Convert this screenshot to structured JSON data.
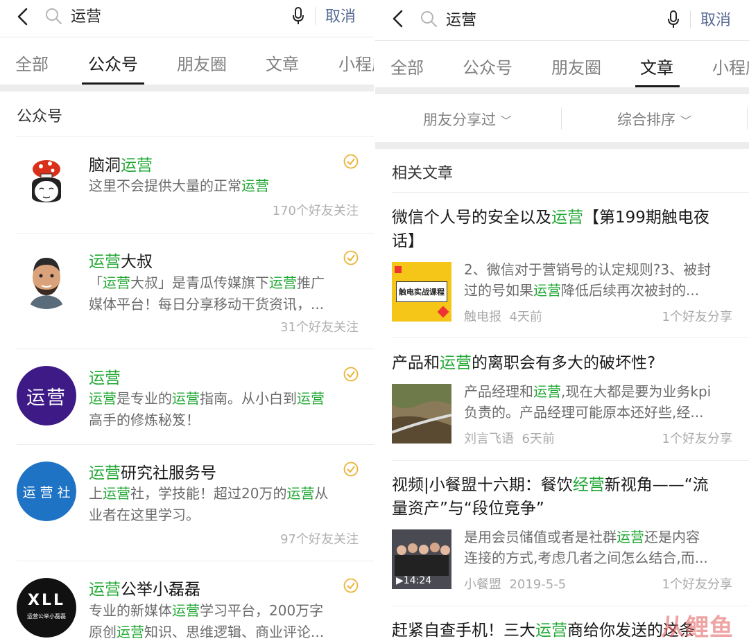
{
  "search": {
    "query": "运营",
    "cancel": "取消"
  },
  "left": {
    "tabs": [
      {
        "label": "全部"
      },
      {
        "label": "公众号"
      },
      {
        "label": "朋友圈"
      },
      {
        "label": "文章"
      },
      {
        "label": "小程序"
      }
    ],
    "active_tab": "公众号",
    "section_title": "公众号",
    "accounts": [
      {
        "name_pre": "脑洞",
        "name_hl": "运营",
        "name_post": "",
        "desc": [
          [
            "这里不会提供大量的正常",
            ""
          ],
          [
            "运营",
            "hl"
          ]
        ],
        "followers": "170个好友关注"
      },
      {
        "name_pre": "",
        "name_hl": "运营",
        "name_post": "大叔",
        "desc_line1": [
          "「",
          "运营",
          "大叔」是青瓜传媒旗下",
          "运营",
          "推广"
        ],
        "desc_line2": "媒体平台！每日分享移动干货资讯，...",
        "followers": "31个好友关注"
      },
      {
        "name_pre": "",
        "name_hl": "运营",
        "name_post": "",
        "avatar_text": "运营",
        "desc_line1": [
          "",
          "运营",
          "是专业的",
          "运营",
          "指南。从小白到",
          "运营"
        ],
        "desc_line2": "高手的修炼秘笈！",
        "followers": ""
      },
      {
        "name_pre": "",
        "name_hl": "运营",
        "name_post": "研究社服务号",
        "avatar_text": "运 营 社",
        "desc_line1": [
          "上",
          "运营",
          "社，学技能！超过20万的",
          "运营",
          "从"
        ],
        "desc_line2": "业者在这里学习。",
        "followers": "97个好友关注"
      },
      {
        "name_pre": "",
        "name_hl": "运营",
        "name_post": "公举小磊磊",
        "avatar_text": "XLL",
        "avatar_sub": "运营公举小磊磊",
        "desc_line1": [
          "专业的新媒体",
          "运营",
          "学习平台，200万字"
        ],
        "desc_line2": [
          "原创",
          "运营",
          "知识、思维逻辑、商业评论..."
        ],
        "followers": ""
      }
    ]
  },
  "right": {
    "tabs": [
      {
        "label": "全部"
      },
      {
        "label": "公众号"
      },
      {
        "label": "朋友圈"
      },
      {
        "label": "文章"
      },
      {
        "label": "小程序"
      }
    ],
    "active_tab": "文章",
    "filters": {
      "shared": "朋友分享过",
      "sort": "综合排序"
    },
    "section_title": "相关文章",
    "articles": [
      {
        "title_parts": [
          "微信个人号的安全以及",
          "运营",
          "【第199期触电夜"
        ],
        "title_line2": "话】",
        "thumb_text": "触电实战课程",
        "snippet_line1": "2、微信对于营销号的认定规则?3、被封",
        "snippet_line2": [
          "过的号如果",
          "运营",
          "降低后续再次被封的..."
        ],
        "source": "触电报",
        "time": "4天前",
        "share": "1个好友分享"
      },
      {
        "title_parts": [
          "产品和",
          "运营",
          "的离职会有多大的破坏性?"
        ],
        "snippet_line1": [
          "产品经理和",
          "运营",
          ",现在大都是要为业务kpi"
        ],
        "snippet_line2": "负责的。产品经理可能原本还好些,经...",
        "source": "刘言飞语",
        "time": "6天前",
        "share": "1个好友分享"
      },
      {
        "title_parts": [
          "视频|小餐盟十六期：餐饮",
          "经营",
          "新视角——“流"
        ],
        "title_line2": "量资产”与“段位竞争”",
        "thumb_duration": "14:24",
        "snippet_line1": [
          "是用会员储值或者是社群",
          "运营",
          "还是内容"
        ],
        "snippet_line2": "连接的方式,考虑几者之间怎么结合,而...",
        "source": "小餐盟",
        "time": "2019-5-5",
        "share": "1个好友分享"
      },
      {
        "title_parts": [
          "赶紧自查手机！三大",
          "运营",
          "商给你发送的这条"
        ]
      }
    ],
    "watermark": "从鲤鱼"
  },
  "colors": {
    "highlight": "#20a833",
    "cancel": "#576b95",
    "muted": "#808080"
  }
}
